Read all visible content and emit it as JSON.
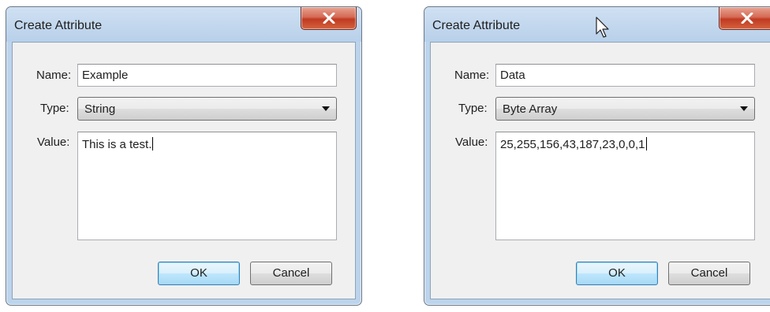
{
  "dialogs": [
    {
      "title": "Create Attribute",
      "name_label": "Name:",
      "name_value": "Example",
      "type_label": "Type:",
      "type_value": "String",
      "value_label": "Value:",
      "value_text": "This is a test.",
      "ok_label": "OK",
      "cancel_label": "Cancel"
    },
    {
      "title": "Create Attribute",
      "name_label": "Name:",
      "name_value": "Data",
      "type_label": "Type:",
      "type_value": "Byte Array",
      "value_label": "Value:",
      "value_text": "25,255,156,43,187,23,0,0,1",
      "ok_label": "OK",
      "cancel_label": "Cancel"
    }
  ],
  "icons": {
    "close": "close-icon",
    "dropdown": "chevron-down-icon",
    "pointer": "mouse-pointer-icon"
  },
  "colors": {
    "close_button": "#c9452f",
    "ok_button_border": "#3c7fb1",
    "frame": "#bcd4ec"
  }
}
